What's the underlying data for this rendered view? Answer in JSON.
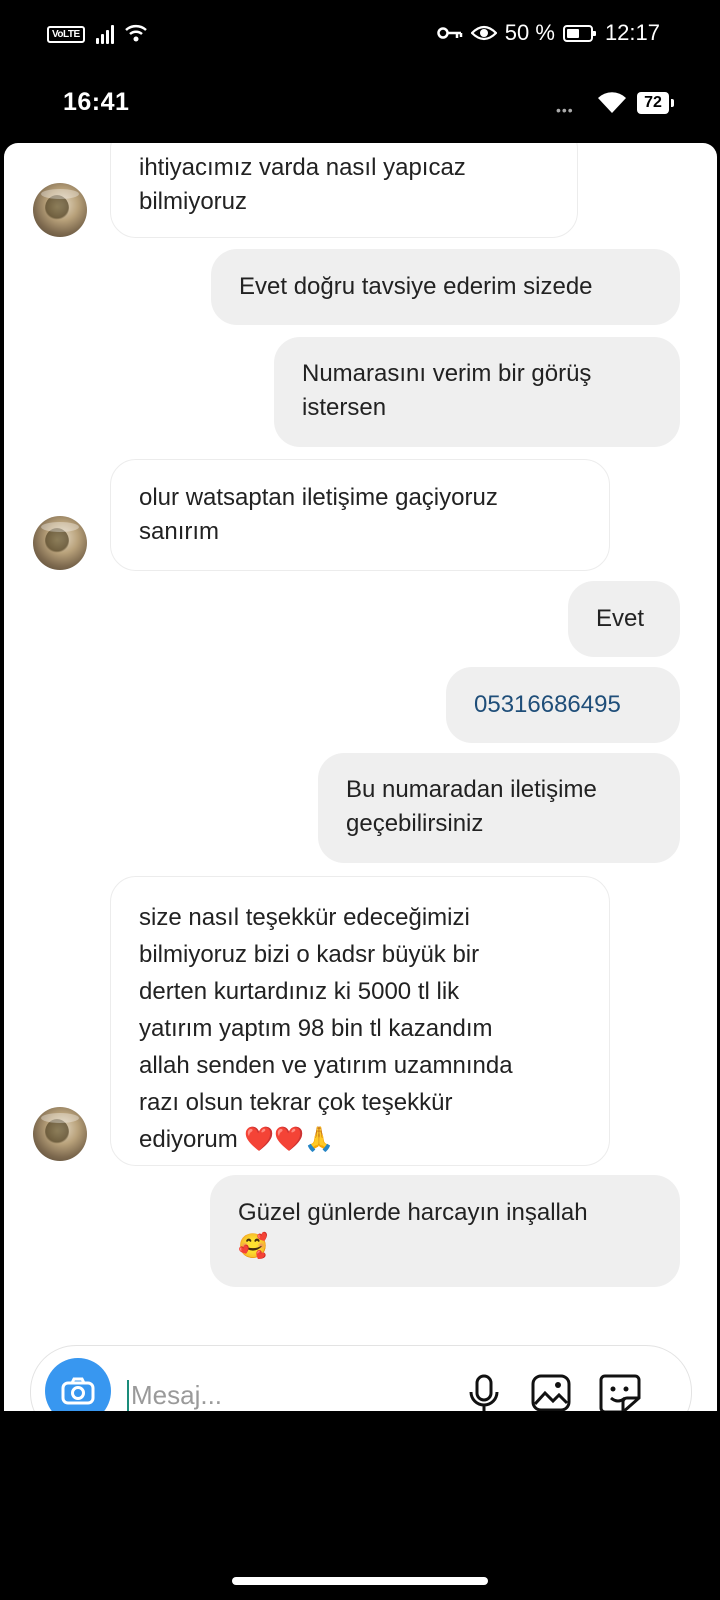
{
  "outer_status": {
    "network_badge": "VoLTE",
    "battery_percent": "50 %",
    "time": "12:17"
  },
  "inner_status": {
    "time": "16:41",
    "battery_level": "72"
  },
  "messages": [
    {
      "dir": "in",
      "lines": [
        "ihtiyacımız varda nasıl yapıcaz",
        "bilmiyoruz"
      ]
    },
    {
      "dir": "out",
      "lines": [
        "Evet doğru tavsiye ederim sizede"
      ]
    },
    {
      "dir": "out",
      "lines": [
        "Numarasını verim bir görüş",
        "istersen"
      ]
    },
    {
      "dir": "in",
      "lines": [
        "olur watsaptan iletişime gaçiyoruz",
        "sanırım"
      ]
    },
    {
      "dir": "out",
      "lines": [
        "Evet"
      ]
    },
    {
      "dir": "out",
      "lines": [
        "05316686495"
      ]
    },
    {
      "dir": "out",
      "lines": [
        "Bu numaradan iletişime",
        "geçebilirsiniz"
      ]
    },
    {
      "dir": "in",
      "lines": [
        "size nasıl teşekkür edeceğimizi",
        "bilmiyoruz bizi o kadsr büyük bir",
        "derten kurtardınız ki 5000 tl lik",
        "yatırım yaptım 98 bin tl kazandım",
        "allah senden ve yatırım uzamnında",
        "razı olsun tekrar çok teşekkür",
        "ediyorum ❤️❤️🙏"
      ]
    },
    {
      "dir": "out",
      "lines": [
        "Güzel günlerde harcayın inşallah",
        "🥰"
      ]
    }
  ],
  "composer": {
    "placeholder": "Mesaj...",
    "icons": [
      "camera-icon",
      "microphone-icon",
      "gallery-icon",
      "sticker-icon"
    ]
  },
  "colors": {
    "accent_blue": "#3897f0",
    "incoming_bubble": "#ffffff",
    "outgoing_bubble": "#efefef",
    "phone_number_link": "#1f4e79"
  }
}
